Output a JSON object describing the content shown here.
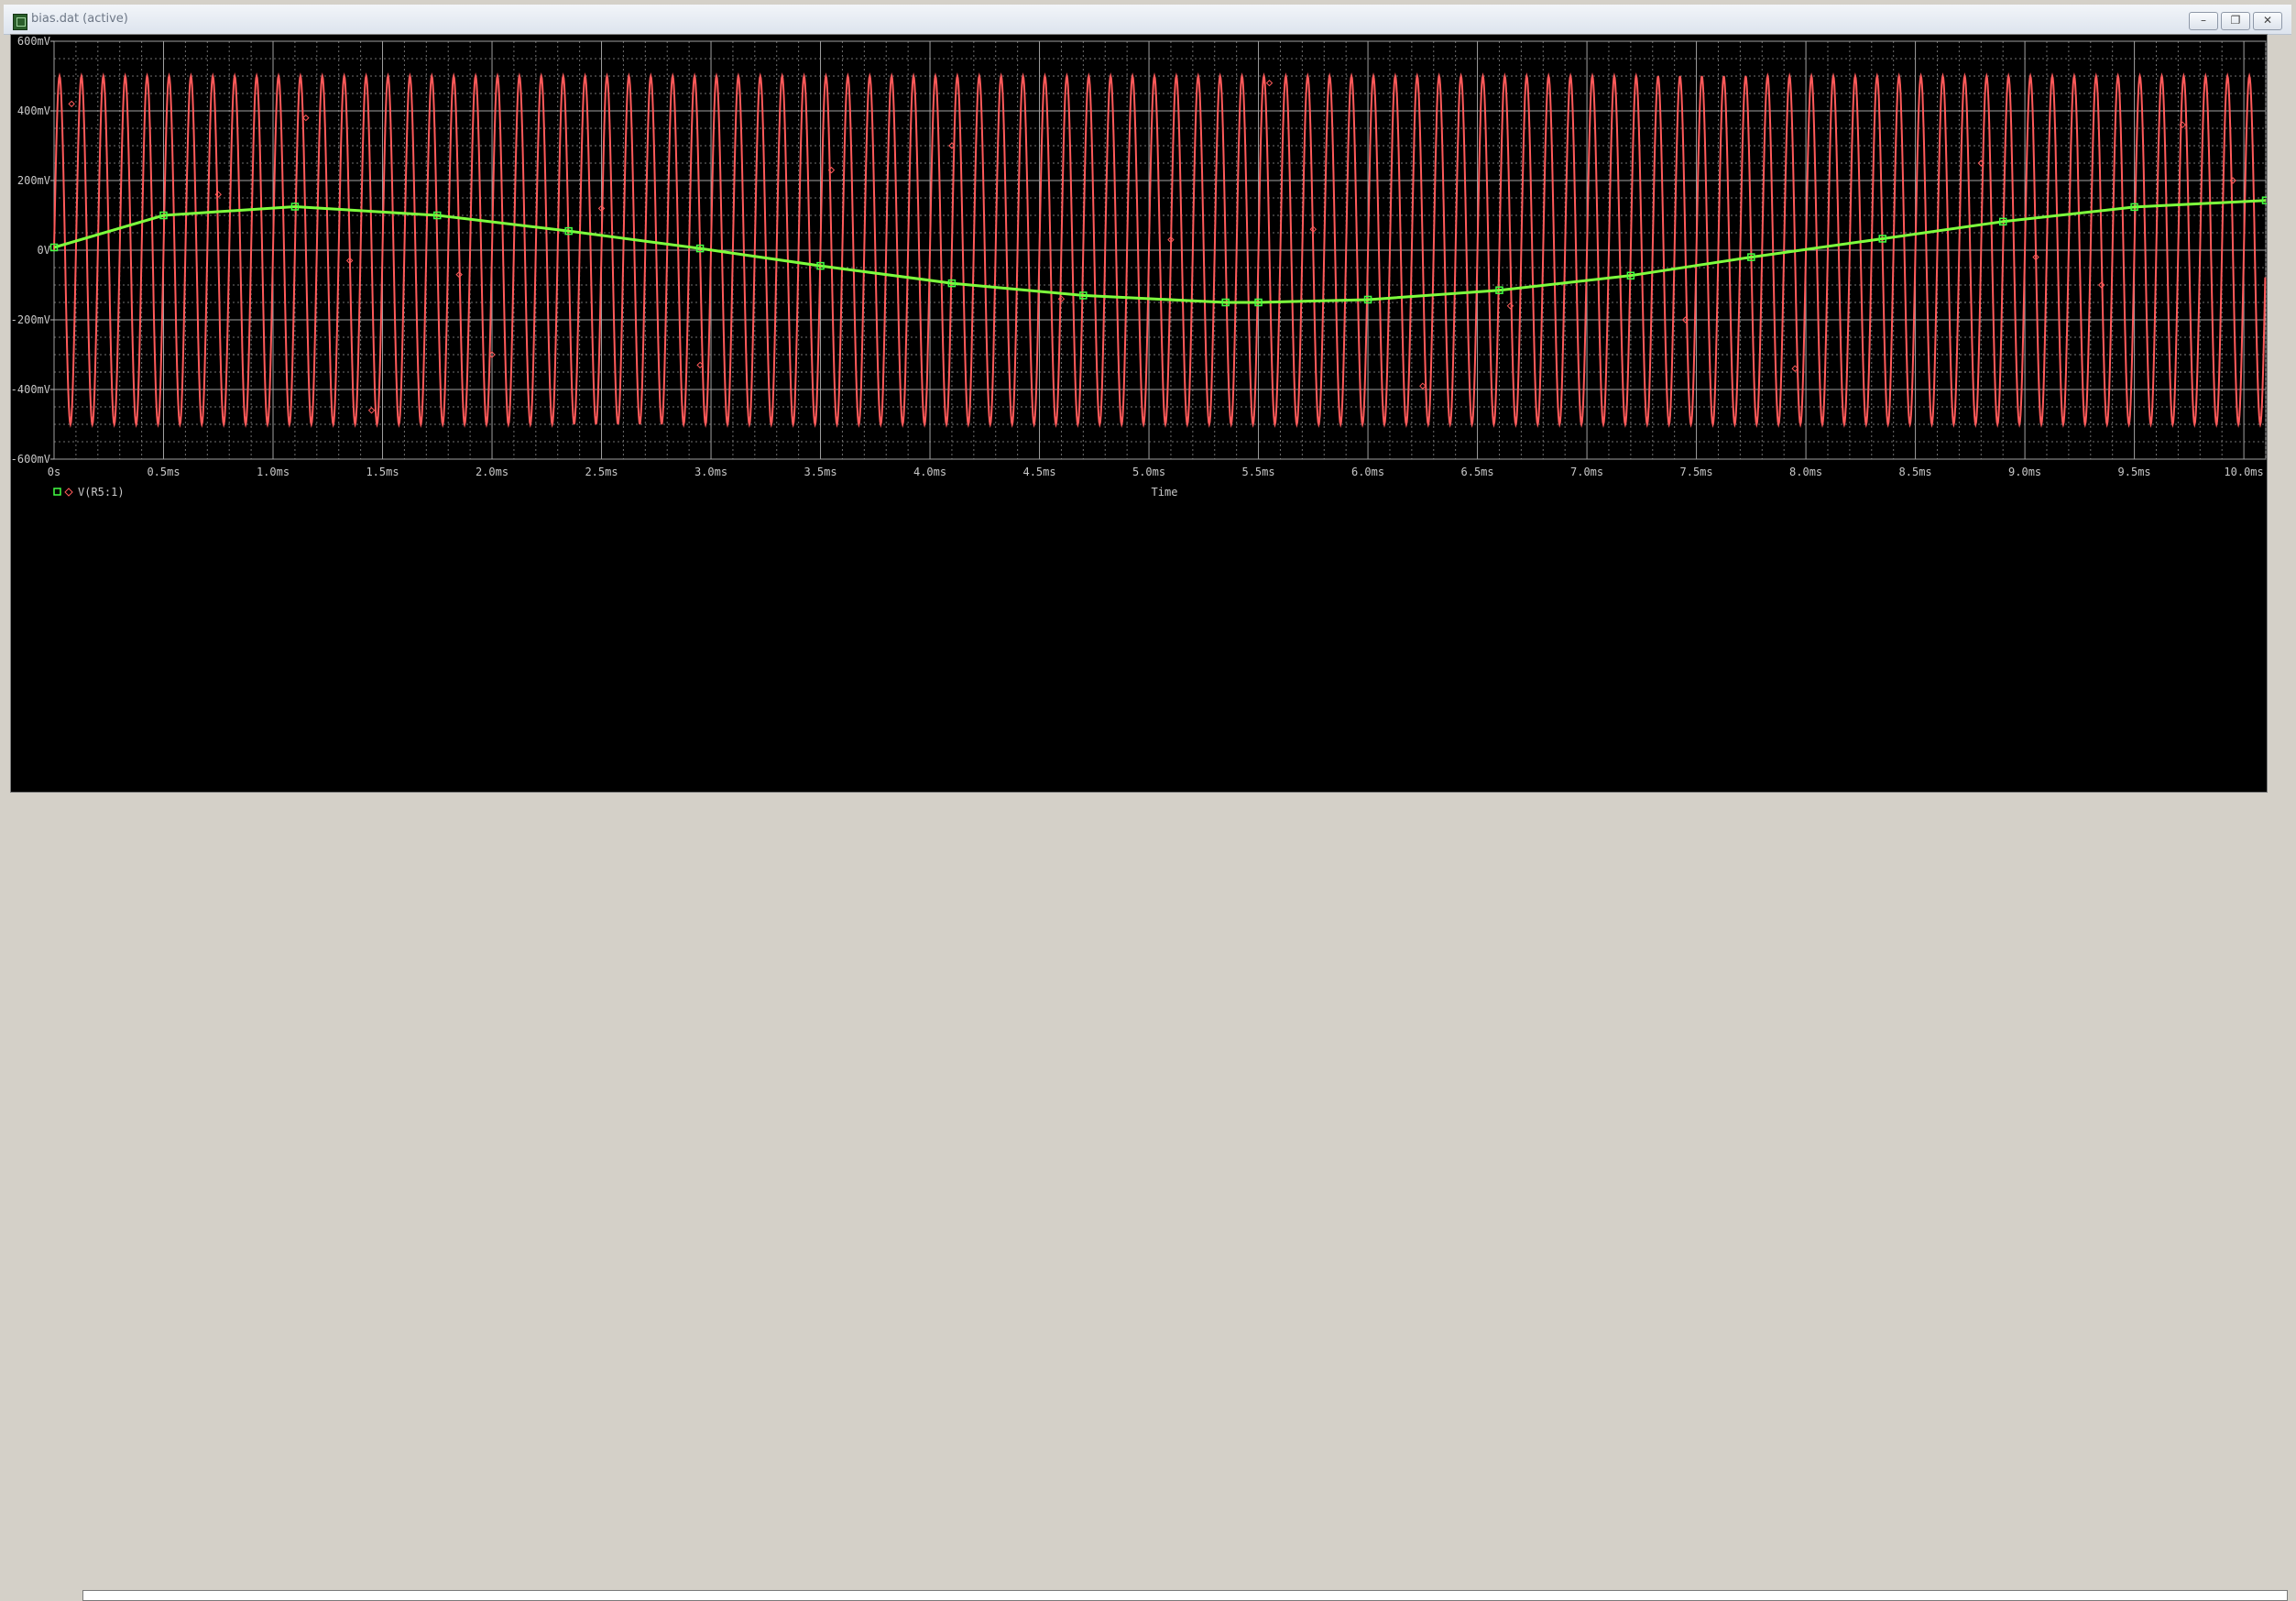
{
  "window": {
    "title": "bias.dat (active)",
    "controls": [
      "minimize",
      "restore",
      "close"
    ]
  },
  "colors": {
    "background": "#000000",
    "grid": "#b8b8b8",
    "axis_text": "#c8c8c8",
    "trace_osc": "#ff5a5a",
    "trace_v": "#7dff3c",
    "marker": "#42ff42"
  },
  "chart_data": {
    "type": "line",
    "xlabel": "Time",
    "ylabel": "",
    "xlim": [
      0,
      10.1
    ],
    "ylim": [
      -600,
      600
    ],
    "x_unit": "ms",
    "y_unit": "mV",
    "xticks": [
      {
        "v": 0,
        "label": "0s"
      },
      {
        "v": 0.5,
        "label": "0.5ms"
      },
      {
        "v": 1.0,
        "label": "1.0ms"
      },
      {
        "v": 1.5,
        "label": "1.5ms"
      },
      {
        "v": 2.0,
        "label": "2.0ms"
      },
      {
        "v": 2.5,
        "label": "2.5ms"
      },
      {
        "v": 3.0,
        "label": "3.0ms"
      },
      {
        "v": 3.5,
        "label": "3.5ms"
      },
      {
        "v": 4.0,
        "label": "4.0ms"
      },
      {
        "v": 4.5,
        "label": "4.5ms"
      },
      {
        "v": 5.0,
        "label": "5.0ms"
      },
      {
        "v": 5.5,
        "label": "5.5ms"
      },
      {
        "v": 6.0,
        "label": "6.0ms"
      },
      {
        "v": 6.5,
        "label": "6.5ms"
      },
      {
        "v": 7.0,
        "label": "7.0ms"
      },
      {
        "v": 7.5,
        "label": "7.5ms"
      },
      {
        "v": 8.0,
        "label": "8.0ms"
      },
      {
        "v": 8.5,
        "label": "8.5ms"
      },
      {
        "v": 9.0,
        "label": "9.0ms"
      },
      {
        "v": 9.5,
        "label": "9.5ms"
      },
      {
        "v": 10.0,
        "label": "10.0ms"
      }
    ],
    "yticks": [
      {
        "v": 600,
        "label": "600mV"
      },
      {
        "v": 400,
        "label": "400mV"
      },
      {
        "v": 200,
        "label": "200mV"
      },
      {
        "v": 0,
        "label": "0V"
      },
      {
        "v": -200,
        "label": "-200mV"
      },
      {
        "v": -400,
        "label": "-400mV"
      },
      {
        "v": -600,
        "label": "-600mV"
      }
    ],
    "grid": true,
    "legend": {
      "position": "bottom-left",
      "entries": [
        {
          "label": "V(R5:1)",
          "markers": [
            "square",
            "diamond"
          ]
        }
      ]
    },
    "series": [
      {
        "style": "oscillation",
        "description_color": "red",
        "amplitude_mV": 500,
        "frequency_kHz": 10,
        "x_range": [
          0,
          10.1
        ],
        "marker": "diamond",
        "marker_points": [
          {
            "x": 0.08,
            "y": 420
          },
          {
            "x": 0.75,
            "y": 160
          },
          {
            "x": 1.15,
            "y": 380
          },
          {
            "x": 1.35,
            "y": -30
          },
          {
            "x": 1.45,
            "y": -460
          },
          {
            "x": 1.85,
            "y": -70
          },
          {
            "x": 2.0,
            "y": -300
          },
          {
            "x": 2.5,
            "y": 120
          },
          {
            "x": 2.95,
            "y": -330
          },
          {
            "x": 3.55,
            "y": 230
          },
          {
            "x": 4.1,
            "y": 300
          },
          {
            "x": 4.6,
            "y": -140
          },
          {
            "x": 5.1,
            "y": 30
          },
          {
            "x": 5.55,
            "y": 480
          },
          {
            "x": 5.75,
            "y": 60
          },
          {
            "x": 6.25,
            "y": -390
          },
          {
            "x": 6.65,
            "y": -160
          },
          {
            "x": 7.45,
            "y": -200
          },
          {
            "x": 7.95,
            "y": -340
          },
          {
            "x": 8.8,
            "y": 250
          },
          {
            "x": 9.05,
            "y": -20
          },
          {
            "x": 9.35,
            "y": -100
          },
          {
            "x": 9.72,
            "y": 360
          },
          {
            "x": 9.95,
            "y": 200
          }
        ]
      },
      {
        "name": "V(R5:1)",
        "description_color": "green",
        "marker": "square",
        "x": [
          0,
          0.5,
          1.1,
          1.75,
          2.35,
          2.95,
          3.5,
          4.1,
          4.7,
          5.35,
          5.5,
          6.0,
          6.6,
          7.2,
          7.75,
          8.35,
          8.9,
          9.5,
          10.1
        ],
        "y": [
          8,
          100,
          125,
          100,
          55,
          5,
          -45,
          -95,
          -130,
          -150,
          -150,
          -142,
          -115,
          -73,
          -20,
          33,
          82,
          124,
          143
        ]
      }
    ]
  }
}
